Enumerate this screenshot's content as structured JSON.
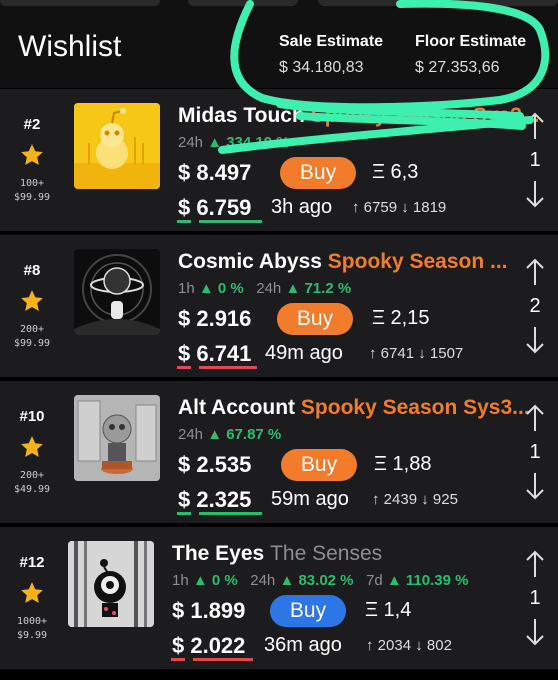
{
  "header": {
    "title": "Wishlist",
    "sale_estimate_label": "Sale Estimate",
    "sale_estimate_value": "$ 34.180,83",
    "floor_estimate_label": "Floor Estimate",
    "floor_estimate_value": "$ 27.353,66"
  },
  "items": [
    {
      "rank": "#2",
      "supply": "100+",
      "supply_price": "$99.99",
      "name": "Midas Touch",
      "collection": "Spooky Season Sys3...",
      "change_24h_label": "24h",
      "change_24h": "▲ 334.19 %",
      "price": "$ 8.497",
      "buy_label": "Buy",
      "eth": "Ξ 6,3",
      "last_sale": "$ 6.759",
      "last_sale_time": "3h ago",
      "votes_up": "↑ 6759",
      "votes_down": "↓ 1819",
      "order": "1"
    },
    {
      "rank": "#8",
      "supply": "200+",
      "supply_price": "$99.99",
      "name": "Cosmic Abyss",
      "collection": "Spooky Season ...",
      "change_1h_label": "1h",
      "change_1h": "▲ 0 %",
      "change_24h_label": "24h",
      "change_24h": "▲ 71.2 %",
      "price": "$ 2.916",
      "buy_label": "Buy",
      "eth": "Ξ 2,15",
      "last_sale": "$ 6.741",
      "last_sale_time": "49m ago",
      "votes_up": "↑ 6741",
      "votes_down": "↓ 1507",
      "order": "2"
    },
    {
      "rank": "#10",
      "supply": "200+",
      "supply_price": "$49.99",
      "name": "Alt Account",
      "collection": "Spooky Season Sys3...",
      "change_24h_label": "24h",
      "change_24h": "▲ 67.87 %",
      "price": "$ 2.535",
      "buy_label": "Buy",
      "eth": "Ξ 1,88",
      "last_sale": "$ 2.325",
      "last_sale_time": "59m ago",
      "votes_up": "↑ 2439",
      "votes_down": "↓ 925",
      "order": "1"
    },
    {
      "rank": "#12",
      "supply": "1000+",
      "supply_price": "$9.99",
      "name": "The Eyes",
      "collection": "The Senses",
      "change_1h_label": "1h",
      "change_1h": "▲ 0 %",
      "change_24h_label": "24h",
      "change_24h": "▲ 83.02 %",
      "change_7d_label": "7d",
      "change_7d": "▲ 110.39 %",
      "price": "$ 1.899",
      "buy_label": "Buy",
      "eth": "Ξ 1,4",
      "last_sale": "$ 2.022",
      "last_sale_time": "36m ago",
      "votes_up": "↑ 2034",
      "votes_down": "↓ 802",
      "order": "1"
    }
  ],
  "colors": {
    "accent_orange": "#f37c2c",
    "buy_blue": "#2d76e6",
    "gain_green": "#2bbd6e",
    "loss_red": "#e5484d",
    "star_gold": "#f5b21b",
    "highlighter": "#3ef0b0"
  },
  "icons": [
    "star-icon",
    "upvote-arrow-icon",
    "downvote-arrow-icon",
    "ethereum-icon",
    "nft-thumbnail"
  ]
}
